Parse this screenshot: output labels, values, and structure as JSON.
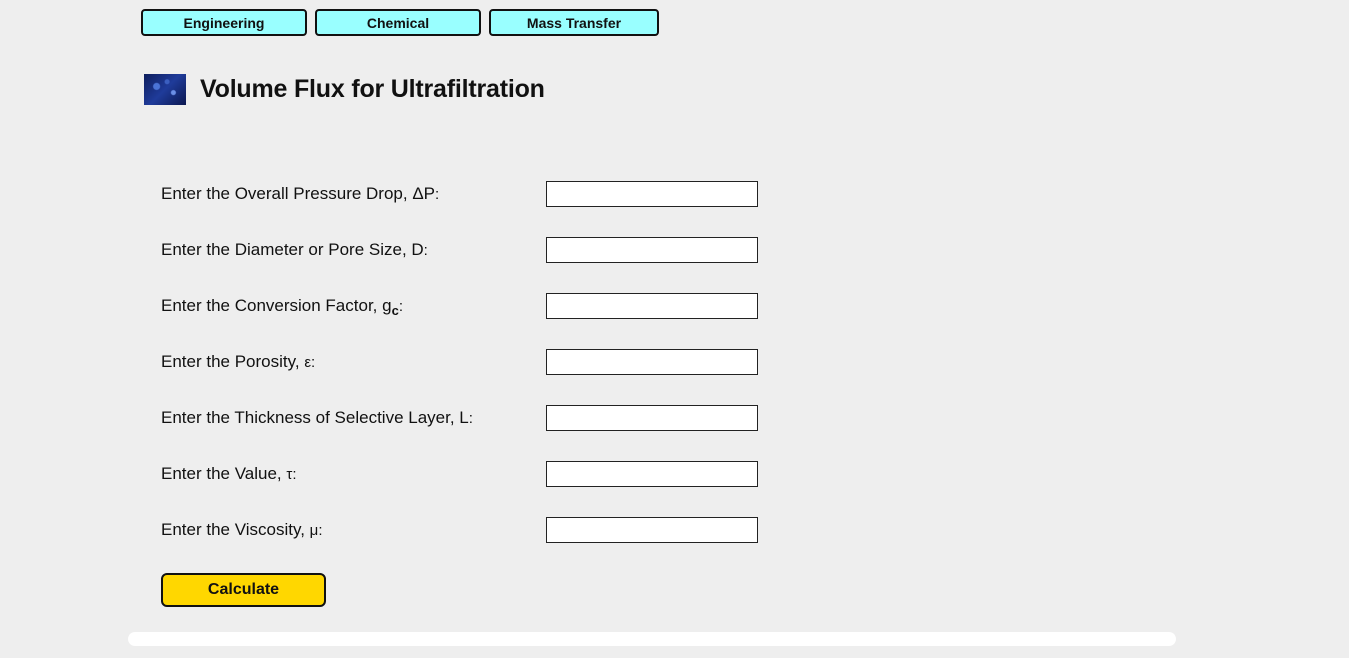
{
  "breadcrumbs": [
    "Engineering",
    "Chemical",
    "Mass Transfer"
  ],
  "page": {
    "title": "Volume Flux for Ultrafiltration"
  },
  "form": {
    "fields": [
      {
        "label": "Enter the Overall Pressure Drop, ",
        "symbol": "ΔP",
        "sub": "",
        "suffix": ":",
        "value": ""
      },
      {
        "label": "Enter the Diameter or Pore Size, ",
        "symbol": "D",
        "sub": "",
        "suffix": ":",
        "value": ""
      },
      {
        "label": "Enter the Conversion Factor, ",
        "symbol": "g",
        "sub": "c",
        "suffix": ":",
        "value": ""
      },
      {
        "label": "Enter the Porosity, ",
        "symbol": "ε",
        "sub": "",
        "suffix": ":",
        "value": ""
      },
      {
        "label": "Enter the Thickness of Selective Layer, ",
        "symbol": "L",
        "sub": "",
        "suffix": ":",
        "value": ""
      },
      {
        "label": "Enter the Value, ",
        "symbol": "τ",
        "sub": "",
        "suffix": ":",
        "value": ""
      },
      {
        "label": "Enter the Viscosity, ",
        "symbol": "μ",
        "sub": "",
        "suffix": ":",
        "value": ""
      }
    ],
    "calculate_label": "Calculate"
  },
  "colors": {
    "background": "#eeeeee",
    "breadcrumb": "#99ffff",
    "calculate": "#ffd700"
  }
}
